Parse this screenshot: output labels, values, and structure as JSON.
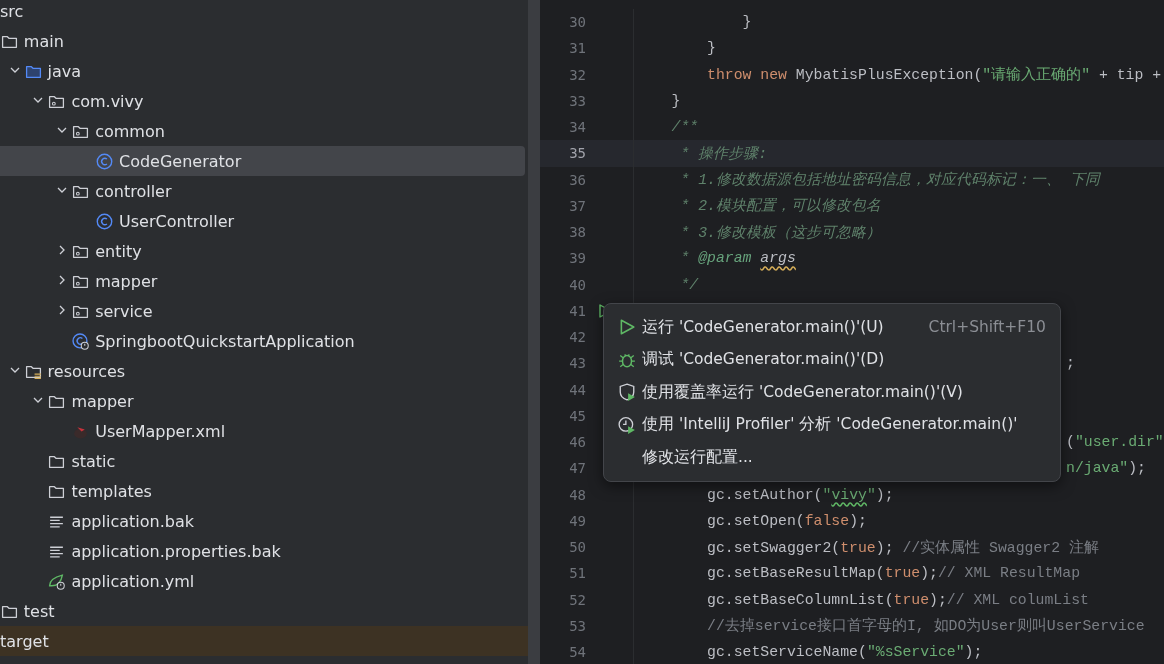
{
  "project_tree": [
    {
      "label": "src",
      "kind": "folder",
      "selected": false,
      "ignored": false,
      "children": [
        {
          "label": "main",
          "kind": "folder",
          "selected": false,
          "ignored": false,
          "children": [
            {
              "label": "java",
              "kind": "source-folder",
              "expanded": true,
              "selected": false,
              "ignored": false,
              "children": [
                {
                  "label": "com.vivy",
                  "kind": "package",
                  "expanded": true,
                  "selected": false,
                  "ignored": false,
                  "children": [
                    {
                      "label": "common",
                      "kind": "package",
                      "expanded": true,
                      "selected": false,
                      "ignored": false,
                      "children": [
                        {
                          "label": "CodeGenerator",
                          "kind": "class",
                          "selected": true,
                          "ignored": false
                        }
                      ]
                    },
                    {
                      "label": "controller",
                      "kind": "package",
                      "expanded": true,
                      "selected": false,
                      "ignored": false,
                      "children": [
                        {
                          "label": "UserController",
                          "kind": "class",
                          "selected": false,
                          "ignored": false
                        }
                      ]
                    },
                    {
                      "label": "entity",
                      "kind": "package",
                      "expanded": false,
                      "selected": false,
                      "ignored": false
                    },
                    {
                      "label": "mapper",
                      "kind": "package",
                      "expanded": false,
                      "selected": false,
                      "ignored": false
                    },
                    {
                      "label": "service",
                      "kind": "package",
                      "expanded": false,
                      "selected": false,
                      "ignored": false
                    },
                    {
                      "label": "SpringbootQuickstartApplication",
                      "kind": "spring-class",
                      "selected": false,
                      "ignored": false
                    }
                  ]
                }
              ]
            },
            {
              "label": "resources",
              "kind": "resource-folder",
              "expanded": true,
              "selected": false,
              "ignored": false,
              "children": [
                {
                  "label": "mapper",
                  "kind": "folder",
                  "expanded": true,
                  "selected": false,
                  "ignored": false,
                  "children": [
                    {
                      "label": "UserMapper.xml",
                      "kind": "mybatis-xml",
                      "selected": false,
                      "ignored": false
                    }
                  ]
                },
                {
                  "label": "static",
                  "kind": "folder",
                  "selected": false,
                  "ignored": false
                },
                {
                  "label": "templates",
                  "kind": "folder",
                  "selected": false,
                  "ignored": false
                },
                {
                  "label": "application.bak",
                  "kind": "text-file",
                  "selected": false,
                  "ignored": false
                },
                {
                  "label": "application.properties.bak",
                  "kind": "text-file",
                  "selected": false,
                  "ignored": false
                },
                {
                  "label": "application.yml",
                  "kind": "spring-config",
                  "selected": false,
                  "ignored": false
                }
              ]
            }
          ]
        },
        {
          "label": "test",
          "kind": "folder",
          "selected": false,
          "ignored": false
        }
      ]
    },
    {
      "label": "target",
      "kind": "folder",
      "selected": false,
      "ignored": true
    }
  ],
  "editor": {
    "lines": [
      {
        "number": "30",
        "kind": "code",
        "current": false,
        "tokens": [
          {
            "kind": "plain",
            "text": "            }"
          }
        ]
      },
      {
        "number": "31",
        "kind": "code",
        "current": false,
        "tokens": [
          {
            "kind": "plain",
            "text": "        }"
          }
        ]
      },
      {
        "number": "32",
        "kind": "code",
        "current": false,
        "tokens": [
          {
            "kind": "keyword",
            "text": "        throw new "
          },
          {
            "kind": "plain",
            "text": "MybatisPlusException("
          },
          {
            "kind": "string",
            "text": "\"请输入正确的\""
          },
          {
            "kind": "plain",
            "text": " + tip +"
          }
        ]
      },
      {
        "number": "33",
        "kind": "code",
        "current": false,
        "tokens": [
          {
            "kind": "plain",
            "text": "    }"
          }
        ]
      },
      {
        "number": "34",
        "kind": "code",
        "current": false,
        "tokens": [
          {
            "kind": "doc",
            "text": "    /**"
          }
        ]
      },
      {
        "number": "35",
        "kind": "code",
        "current": true,
        "tokens": [
          {
            "kind": "doc",
            "text": "     * 操作步骤:"
          }
        ]
      },
      {
        "number": "36",
        "kind": "code",
        "current": false,
        "tokens": [
          {
            "kind": "doc",
            "text": "     * 1.修改数据源包括地址密码信息，对应代码标记：一、 下同"
          }
        ]
      },
      {
        "number": "37",
        "kind": "code",
        "current": false,
        "tokens": [
          {
            "kind": "doc",
            "text": "     * 2.模块配置，可以修改包名"
          }
        ]
      },
      {
        "number": "38",
        "kind": "code",
        "current": false,
        "tokens": [
          {
            "kind": "doc",
            "text": "     * 3.修改模板（这步可忽略）"
          }
        ]
      },
      {
        "number": "39",
        "kind": "code",
        "current": false,
        "tokens": [
          {
            "kind": "doc",
            "text": "     * "
          },
          {
            "kind": "doc-tag",
            "text": "@param "
          },
          {
            "kind": "typo",
            "text": "args"
          }
        ]
      },
      {
        "number": "40",
        "kind": "code",
        "current": false,
        "tokens": [
          {
            "kind": "doc",
            "text": "     */"
          }
        ]
      },
      {
        "number": "41",
        "kind": "run-marker",
        "current": false
      },
      {
        "number": "42",
        "kind": "blank",
        "current": false
      },
      {
        "number": "43",
        "kind": "partly-covered",
        "current": false,
        "tokens": [
          {
            "kind": "plain",
            "text": ";"
          }
        ]
      },
      {
        "number": "44",
        "kind": "blank",
        "current": false
      },
      {
        "number": "45",
        "kind": "blank",
        "current": false
      },
      {
        "number": "46",
        "kind": "partly-covered",
        "current": false,
        "tokens": [
          {
            "kind": "plain",
            "text": "("
          },
          {
            "kind": "string",
            "text": "\"user.dir\""
          }
        ]
      },
      {
        "number": "47",
        "kind": "partly-covered",
        "current": false,
        "tokens": [
          {
            "kind": "string",
            "text": "n/java\""
          },
          {
            "kind": "plain",
            "text": ");"
          }
        ]
      },
      {
        "number": "48",
        "kind": "code",
        "current": false,
        "tokens": [
          {
            "kind": "plain",
            "text": "        gc.setAuthor("
          },
          {
            "kind": "string",
            "text": "\""
          },
          {
            "kind": "string-typo",
            "text": "vivy"
          },
          {
            "kind": "string",
            "text": "\""
          },
          {
            "kind": "plain",
            "text": ");"
          }
        ]
      },
      {
        "number": "49",
        "kind": "code",
        "current": false,
        "tokens": [
          {
            "kind": "plain",
            "text": "        gc.setOpen("
          },
          {
            "kind": "keyword",
            "text": "false"
          },
          {
            "kind": "plain",
            "text": ");"
          }
        ]
      },
      {
        "number": "50",
        "kind": "code",
        "current": false,
        "tokens": [
          {
            "kind": "plain",
            "text": "        gc.setSwagger2("
          },
          {
            "kind": "keyword",
            "text": "true"
          },
          {
            "kind": "plain",
            "text": "); "
          },
          {
            "kind": "comment",
            "text": "//实体属性 Swagger2 注解"
          }
        ]
      },
      {
        "number": "51",
        "kind": "code",
        "current": false,
        "tokens": [
          {
            "kind": "plain",
            "text": "        gc.setBaseResultMap("
          },
          {
            "kind": "keyword",
            "text": "true"
          },
          {
            "kind": "plain",
            "text": ");"
          },
          {
            "kind": "comment",
            "text": "// XML ResultMap"
          }
        ]
      },
      {
        "number": "52",
        "kind": "code",
        "current": false,
        "tokens": [
          {
            "kind": "plain",
            "text": "        gc.setBaseColumnList("
          },
          {
            "kind": "keyword",
            "text": "true"
          },
          {
            "kind": "plain",
            "text": ");"
          },
          {
            "kind": "comment",
            "text": "// XML columList"
          }
        ]
      },
      {
        "number": "53",
        "kind": "code",
        "current": false,
        "tokens": [
          {
            "kind": "comment",
            "text": "        //去掉service接口首字母的I, 如DO为User则叫UserService"
          }
        ]
      },
      {
        "number": "54",
        "kind": "code",
        "current": false,
        "tokens": [
          {
            "kind": "plain",
            "text": "        gc.setServiceName("
          },
          {
            "kind": "string",
            "text": "\"%sService\""
          },
          {
            "kind": "plain",
            "text": ");"
          }
        ]
      }
    ]
  },
  "context_menu": {
    "items": [
      {
        "kind": "run",
        "label": "运行 'CodeGenerator.main()'(U)",
        "shortcut": "Ctrl+Shift+F10"
      },
      {
        "kind": "debug",
        "label": "调试 'CodeGenerator.main()'(D)"
      },
      {
        "kind": "coverage",
        "label": "使用覆盖率运行 'CodeGenerator.main()'(V)"
      },
      {
        "kind": "profiler",
        "label": "使用 'IntelliJ Profiler' 分析  'CodeGenerator.main()'"
      },
      {
        "kind": "plain",
        "label": "修改运行配置..."
      }
    ]
  }
}
